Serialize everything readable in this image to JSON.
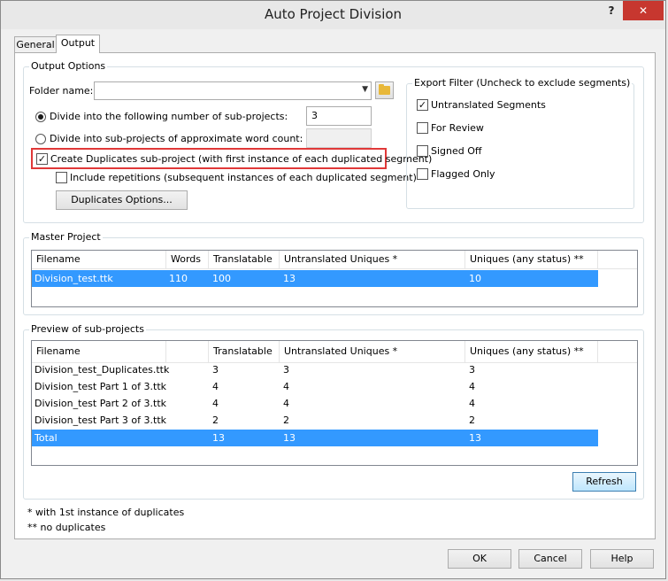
{
  "window": {
    "title": "Auto Project Division",
    "help": "?",
    "close": "✕"
  },
  "tabs": [
    {
      "label": "General"
    },
    {
      "label": "Output"
    }
  ],
  "output_options": {
    "group_label": "Output Options",
    "folder_label": "Folder name:",
    "folder_value": "",
    "radio_subprojects": "Divide into the following number of sub-projects:",
    "subprojects_value": "3",
    "radio_wordcount": "Divide into sub-projects of approximate word count:",
    "wordcount_value": "",
    "create_duplicates": "Create Duplicates sub-project (with first instance of each duplicated segment)",
    "include_repetitions": "Include repetitions (subsequent instances of each duplicated segment)",
    "duplicates_options_btn": "Duplicates Options..."
  },
  "export_filter": {
    "group_label": "Export Filter (Uncheck to exclude segments)",
    "items": [
      {
        "label": "Untranslated Segments",
        "checked": true
      },
      {
        "label": "For Review",
        "checked": false
      },
      {
        "label": "Signed Off",
        "checked": false
      },
      {
        "label": "Flagged Only",
        "checked": false
      }
    ]
  },
  "master_project": {
    "group_label": "Master Project",
    "columns": [
      "Filename",
      "Words",
      "Translatable",
      "Untranslated Uniques *",
      "Uniques (any status) **"
    ],
    "rows": [
      [
        "Division_test.ttk",
        "110",
        "100",
        "13",
        "10"
      ]
    ]
  },
  "preview": {
    "group_label": "Preview of sub-projects",
    "columns": [
      "Filename",
      "",
      "Translatable",
      "Untranslated Uniques *",
      "Uniques (any status) **"
    ],
    "rows": [
      [
        "Division_test_Duplicates.ttk",
        "",
        "3",
        "3",
        "3"
      ],
      [
        "Division_test Part 1 of 3.ttk",
        "",
        "4",
        "4",
        "4"
      ],
      [
        "Division_test Part 2 of 3.ttk",
        "",
        "4",
        "4",
        "4"
      ],
      [
        "Division_test Part 3 of 3.ttk",
        "",
        "2",
        "2",
        "2"
      ],
      [
        "Total",
        "",
        "13",
        "13",
        "13"
      ]
    ],
    "refresh_btn": "Refresh"
  },
  "notes": {
    "note1": "* with 1st instance of duplicates",
    "note2": "** no duplicates"
  },
  "footer": {
    "ok": "OK",
    "cancel": "Cancel",
    "help": "Help"
  },
  "colors": {
    "selection": "#3399ff",
    "highlight_box": "#e03838",
    "close_button": "#c7372f"
  }
}
